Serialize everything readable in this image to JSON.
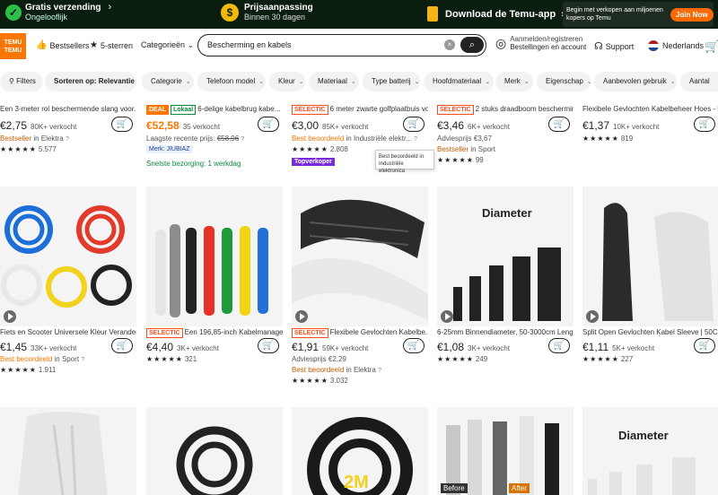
{
  "promo": {
    "shipping_title": "Gratis verzending",
    "shipping_sub": "Ongelooflijk",
    "price_title": "Prijsaanpassing",
    "price_sub": "Binnen 30 dagen",
    "app_label": "Download de Temu-app",
    "seller_text": "Begin met verkopen aan miljoenen kopers op Temu",
    "join_label": "Join Now"
  },
  "header": {
    "logo_line1": "ТЕМU",
    "logo_line2": "TEMU",
    "bestsellers": "Bestsellers",
    "five_stars": "5-sterren",
    "categories": "Categorieën",
    "search_value": "Bescherming en kabels",
    "account_line1": "Aanmelden/registreren",
    "account_line2": "Bestellingen en account",
    "support": "Support",
    "language": "Nederlands"
  },
  "filters": [
    "Filters",
    "Sorteren op: Relevantie",
    "Categorie",
    "Telefoon model",
    "Kleur",
    "Materiaal",
    "Type batterij",
    "Hoofdmateriaal",
    "Merk",
    "Eigenschap",
    "Aanbevolen gebruik",
    "Aantal"
  ],
  "row1": [
    {
      "title": "Een 3-meter rol beschermende slang voor...",
      "price": "€2,75",
      "sold": "80K+ verkocht",
      "meta1_hl": "Bestseller",
      "meta1_rest": " in Elektra",
      "stars": "★★★★★",
      "reviews": "5.577"
    },
    {
      "badge1": "DEAL",
      "badge2": "Lokaal",
      "title": "6-delige kabelbrug kabe...",
      "price": "€52,58",
      "sold": "35 verkocht",
      "meta1": "Laagste recente prijs: ",
      "meta1_strike": "€58,96",
      "merk": "Merk: JIUBIAZ",
      "delivery": "Snelste bezorging: 1 werkdag"
    },
    {
      "badge1": "SELECTIC",
      "title": "6 meter zwarte golfplaatbuis vo...",
      "price": "€3,00",
      "sold": "85K+ verkocht",
      "meta1_hl": "Best beoordeeld",
      "meta1_rest": " in Industriële elektr...",
      "stars": "★★★★★",
      "reviews": "2.808",
      "topkoper": "Topverkoper",
      "tooltip": "Best beoordeeld in Industriële elektronica"
    },
    {
      "badge1": "SELECTIC",
      "title": "2 stuks draadboom bescherming...",
      "price": "€3,46",
      "sold": "6K+ verkocht",
      "meta1": "Adviesprijs €3,67",
      "meta2_hl": "Bestseller",
      "meta2_rest": " in Sport",
      "stars": "★★★★★",
      "reviews": "99"
    },
    {
      "title": "Flexibele Gevlochten Kabelbeheer Hoes - 5...",
      "price": "€1,37",
      "sold": "10K+ verkocht",
      "stars": "★★★★★",
      "reviews": "819"
    }
  ],
  "row2": [
    {
      "title": "Fiets en Scooter Universele Kleur Verander...",
      "price": "€1,45",
      "sold": "33K+ verkocht",
      "meta1_hl": "Best beoordeeld",
      "meta1_rest": " in Sport",
      "stars": "★★★★★",
      "reviews": "1.911"
    },
    {
      "badge1": "SELECTIC",
      "title": "Een 196,85-inch Kabelmanage...",
      "price": "€4,40",
      "sold": "3K+ verkocht",
      "stars": "★★★★★",
      "reviews": "321"
    },
    {
      "badge1": "SELECTIC",
      "title": "Flexibele Gevlochten Kabelbe...",
      "price": "€1,91",
      "sold": "59K+ verkocht",
      "meta1": "Adviesprijs €2,29",
      "meta2_hl": "Best beoordeeld",
      "meta2_rest": " in Elektra",
      "stars": "★★★★★",
      "reviews": "3.032"
    },
    {
      "title": "6-25mm Binnendiameter, 50-3000cm Leng...",
      "price": "€1,08",
      "sold": "3K+ verkocht",
      "stars": "★★★★★",
      "reviews": "249",
      "image_text": "Diameter"
    },
    {
      "title": "Split Open Gevlochten Kabel Sleeve | 50C...",
      "price": "€1,11",
      "sold": "5K+ verkocht",
      "stars": "★★★★★",
      "reviews": "227"
    }
  ],
  "row3": {
    "img3_text": "2M",
    "img4_before": "Before",
    "img4_after": "After",
    "img5_text": "Diameter"
  },
  "colors": {
    "accent": "#fb7701",
    "banner": "#0b1d0f"
  }
}
